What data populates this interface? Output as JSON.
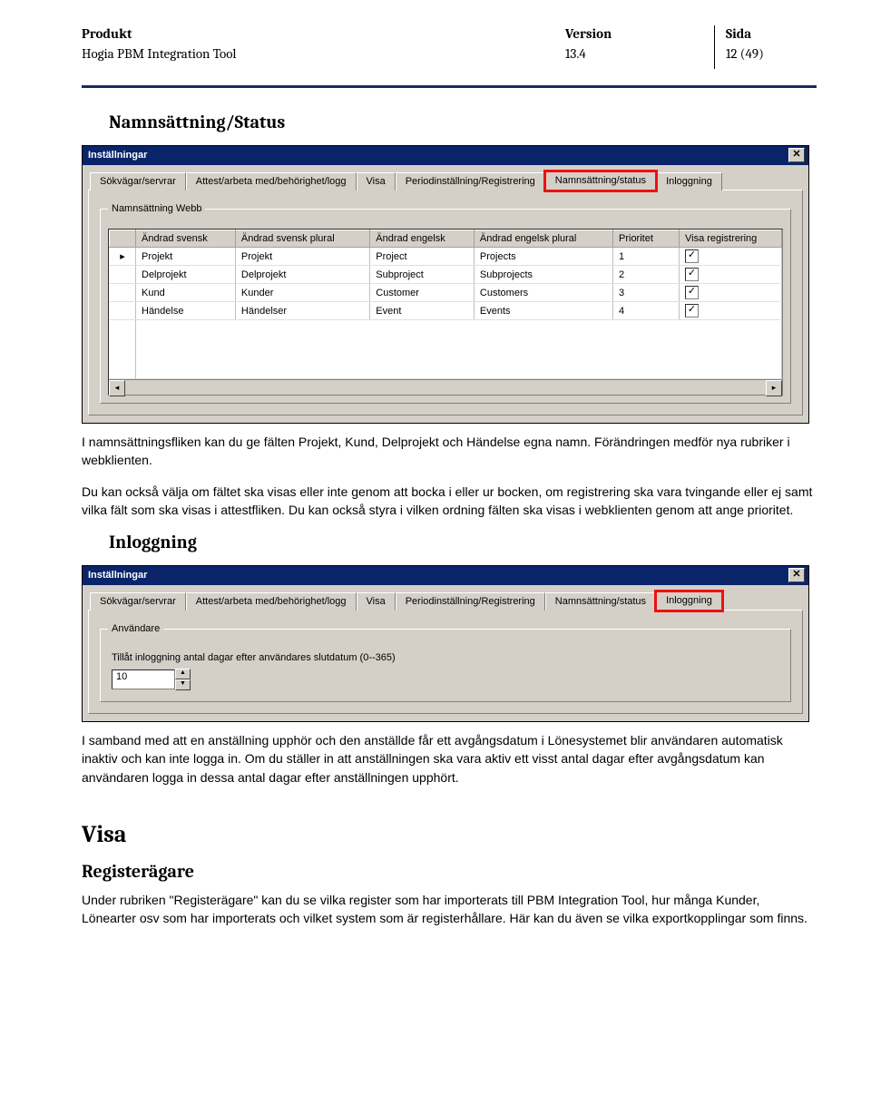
{
  "header": {
    "col1_label": "Produkt",
    "col1_value": "Hogia PBM Integration Tool",
    "col2_label": "Version",
    "col2_value": "13.4",
    "col3_label": "Sida",
    "col3_value": "12 (49)"
  },
  "section1_title": "Namnsättning/Status",
  "shot1": {
    "window_title": "Inställningar",
    "tabs": [
      "Sökvägar/servrar",
      "Attest/arbeta med/behörighet/logg",
      "Visa",
      "Periodinställning/Registrering",
      "Namnsättning/status",
      "Inloggning"
    ],
    "highlight_tab": "Namnsättning/status",
    "group_legend": "Namnsättning Webb",
    "columns": [
      "Ändrad svensk",
      "Ändrad svensk plural",
      "Ändrad engelsk",
      "Ändrad engelsk plural",
      "Prioritet",
      "Visa registrering"
    ],
    "rows": [
      {
        "sv": "Projekt",
        "svp": "Projekt",
        "en": "Project",
        "enp": "Projects",
        "prio": "1",
        "reg": true,
        "current": true
      },
      {
        "sv": "Delprojekt",
        "svp": "Delprojekt",
        "en": "Subproject",
        "enp": "Subprojects",
        "prio": "2",
        "reg": true,
        "current": false
      },
      {
        "sv": "Kund",
        "svp": "Kunder",
        "en": "Customer",
        "enp": "Customers",
        "prio": "3",
        "reg": true,
        "current": false
      },
      {
        "sv": "Händelse",
        "svp": "Händelser",
        "en": "Event",
        "enp": "Events",
        "prio": "4",
        "reg": true,
        "current": false
      }
    ]
  },
  "para1": "I namnsättningsfliken kan du ge fälten Projekt, Kund, Delprojekt och Händelse egna namn. Förändringen medför nya rubriker i webklienten.",
  "para2": "Du kan också välja om fältet ska visas eller inte genom att bocka i eller ur bocken, om registrering ska vara tvingande eller ej samt vilka fält som ska visas i attestfliken. Du kan också styra i vilken ordning fälten ska visas i webklienten genom att ange prioritet.",
  "section2_title": "Inloggning",
  "shot2": {
    "window_title": "Inställningar",
    "tabs": [
      "Sökvägar/servrar",
      "Attest/arbeta med/behörighet/logg",
      "Visa",
      "Periodinställning/Registrering",
      "Namnsättning/status",
      "Inloggning"
    ],
    "highlight_tab": "Inloggning",
    "group_legend": "Användare",
    "field_label": "Tillåt inloggning antal dagar efter användares slutdatum (0--365)",
    "field_value": "10"
  },
  "para3": "I samband med att en anställning upphör och den anställde får ett avgångsdatum i Lönesystemet blir användaren automatisk inaktiv och kan inte logga in. Om du ställer in att anställningen ska vara aktiv ett visst antal dagar efter avgångsdatum kan användaren logga in dessa antal dagar efter anställningen upphört.",
  "section3_h2": "Visa",
  "section3_h3": "Registerägare",
  "para4": "Under rubriken \"Registerägare\" kan du se vilka register som har importerats till PBM Integration Tool, hur många Kunder, Lönearter osv som har importerats och vilket system som är registerhållare. Här kan du även se vilka exportkopplingar som finns."
}
